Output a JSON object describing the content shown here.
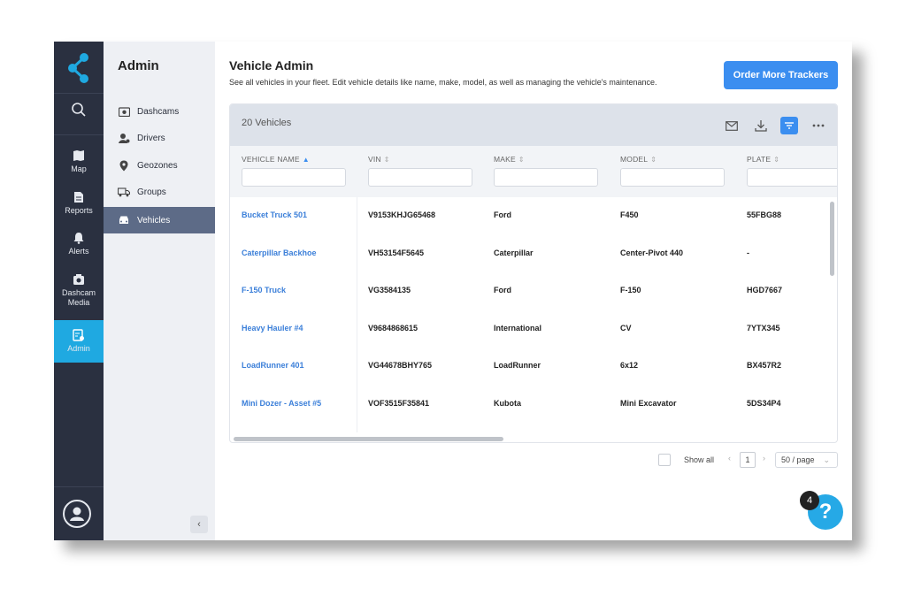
{
  "rail": {
    "items": [
      {
        "label": "Map",
        "icon": "map-icon"
      },
      {
        "label": "Reports",
        "icon": "report-icon"
      },
      {
        "label": "Alerts",
        "icon": "bell-icon"
      },
      {
        "label": "Dashcam Media",
        "icon": "camera-icon"
      },
      {
        "label": "Admin",
        "icon": "admin-icon"
      }
    ],
    "active_color": "#1fa9e1"
  },
  "sidebar": {
    "title": "Admin",
    "items": [
      {
        "label": "Dashcams",
        "icon": "camera-icon"
      },
      {
        "label": "Drivers",
        "icon": "drivers-icon"
      },
      {
        "label": "Geozones",
        "icon": "pin-icon"
      },
      {
        "label": "Groups",
        "icon": "truck-icon"
      },
      {
        "label": "Vehicles",
        "icon": "car-icon"
      }
    ],
    "selected": "Vehicles"
  },
  "main": {
    "title": "Vehicle Admin",
    "subtitle": "See all vehicles in your fleet. Edit vehicle details like name, make, model, as well as managing the vehicle's maintenance.",
    "order_button": "Order More Trackers"
  },
  "table": {
    "count_label": "20 Vehicles",
    "columns": [
      "VEHICLE NAME",
      "VIN",
      "MAKE",
      "MODEL",
      "PLATE"
    ],
    "rows": [
      {
        "name": "Bucket Truck 501",
        "vin": "V9153KHJG65468",
        "make": "Ford",
        "model": "F450",
        "plate": "55FBG88"
      },
      {
        "name": "Caterpillar Backhoe",
        "vin": "VH53154F5645",
        "make": "Caterpillar",
        "model": "Center-Pivot 440",
        "plate": "-"
      },
      {
        "name": "F-150 Truck",
        "vin": "VG3584135",
        "make": "Ford",
        "model": "F-150",
        "plate": "HGD7667"
      },
      {
        "name": "Heavy Hauler #4",
        "vin": "V9684868615",
        "make": "International",
        "model": "CV",
        "plate": "7YTX345"
      },
      {
        "name": "LoadRunner 401",
        "vin": "VG44678BHY765",
        "make": "LoadRunner",
        "model": "6x12",
        "plate": "BX457R2"
      },
      {
        "name": "Mini Dozer - Asset #5",
        "vin": "VOF3515F35841",
        "make": "Kubota",
        "model": "Mini Excavator",
        "plate": "5DS34P4"
      }
    ]
  },
  "pager": {
    "show_all": "Show all",
    "page": "1",
    "per_page": "50 / page"
  },
  "help": {
    "badge": "4",
    "glyph": "?"
  }
}
